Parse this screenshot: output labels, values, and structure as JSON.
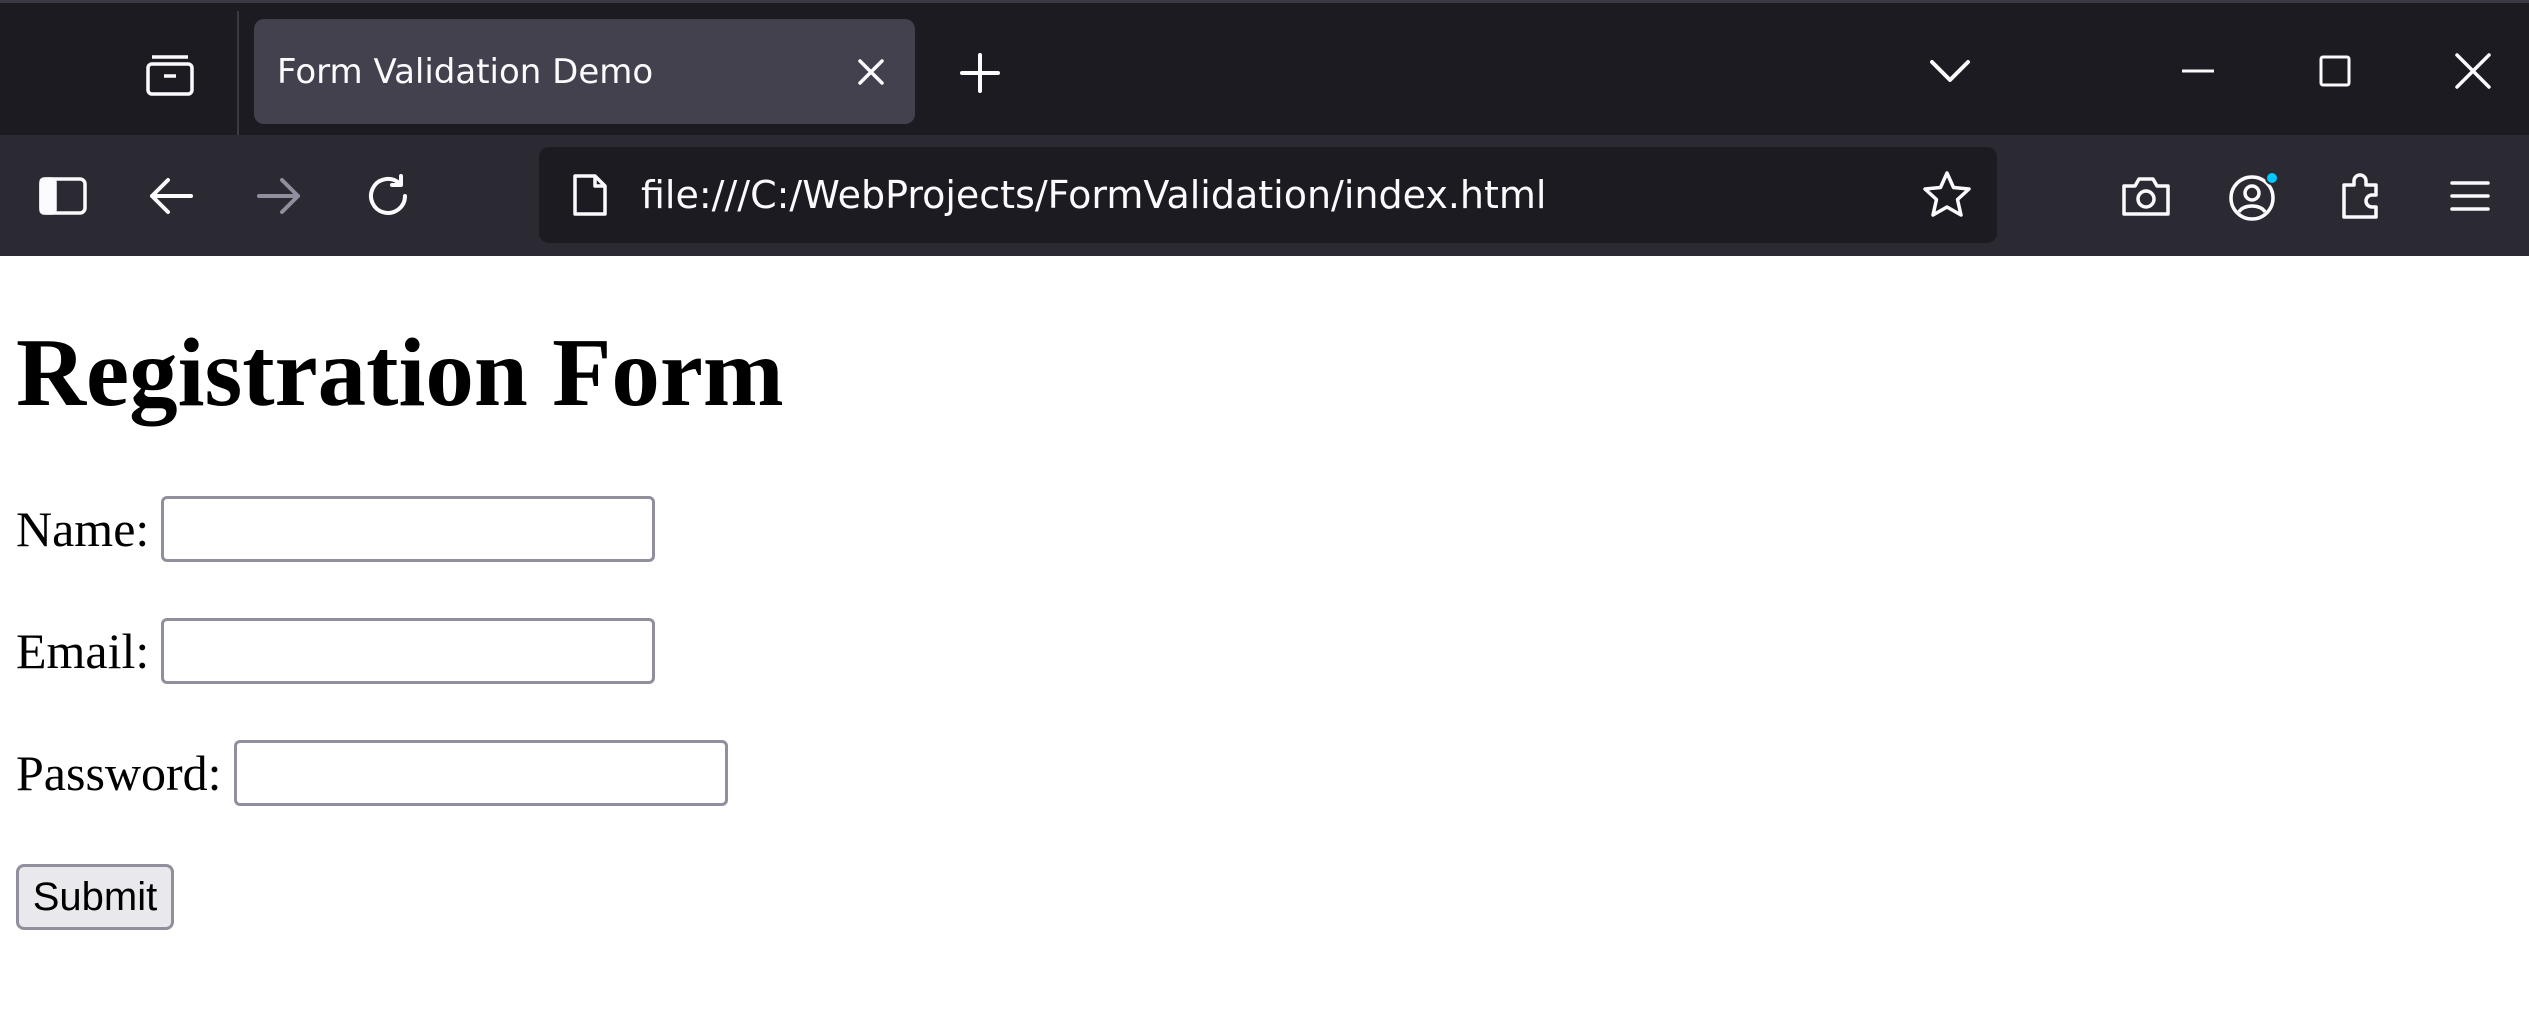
{
  "browser": {
    "tab": {
      "title": "Form Validation Demo"
    },
    "url": "file:///C:/WebProjects/FormValidation/index.html",
    "colors": {
      "tabbar_bg": "#1c1b22",
      "toolbar_bg": "#2b2a33",
      "active_tab_bg": "#42414d",
      "text": "#fbfbfe",
      "disabled_icon": "#8f8f9d",
      "notification_dot": "#00c8ff"
    },
    "icons": {
      "tab_manager": "tab-manager-icon",
      "tab_close": "close-icon",
      "new_tab": "plus-icon",
      "tab_list": "chevron-down-icon",
      "minimize": "minimize-icon",
      "maximize": "maximize-icon",
      "close_window": "close-icon",
      "sidebar": "sidebar-icon",
      "back": "back-arrow-icon",
      "forward": "forward-arrow-icon",
      "reload": "reload-icon",
      "page": "page-icon",
      "bookmark": "star-icon",
      "screenshot": "camera-icon",
      "account": "account-icon",
      "extensions": "puzzle-icon",
      "menu": "hamburger-menu-icon"
    }
  },
  "page": {
    "title": "Registration Form",
    "form": {
      "name_label": "Name:",
      "name_value": "",
      "email_label": "Email:",
      "email_value": "",
      "password_label": "Password:",
      "password_value": "",
      "submit_label": "Submit"
    }
  }
}
